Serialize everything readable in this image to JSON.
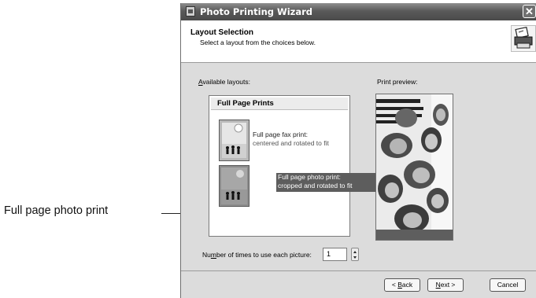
{
  "callout": {
    "label": "Full page photo print"
  },
  "window": {
    "title": "Photo Printing Wizard",
    "close_glyph": "✕",
    "icon": "printer-wizard-icon"
  },
  "header": {
    "title": "Layout Selection",
    "subtitle": "Select a layout from the choices below.",
    "logo_icon": "printer-photos-icon"
  },
  "layouts": {
    "label_first": "A",
    "label_rest": "vailable layouts:",
    "group_title": "Full Page Prints",
    "options": [
      {
        "line1": "Full page fax print:",
        "line2": "centered and rotated to fit",
        "selected": false
      },
      {
        "line1": "Full page photo print:",
        "line2": "cropped and rotated to fit",
        "selected": true
      }
    ]
  },
  "preview": {
    "label": "Print preview:"
  },
  "copies": {
    "label_pre": "Nu",
    "label_u": "m",
    "label_post": "ber of times to use each picture:",
    "value": "1"
  },
  "buttons": {
    "back": {
      "pre": "< ",
      "u": "B",
      "post": "ack"
    },
    "next": {
      "pre": "",
      "u": "N",
      "post": "ext >"
    },
    "cancel": "Cancel"
  }
}
